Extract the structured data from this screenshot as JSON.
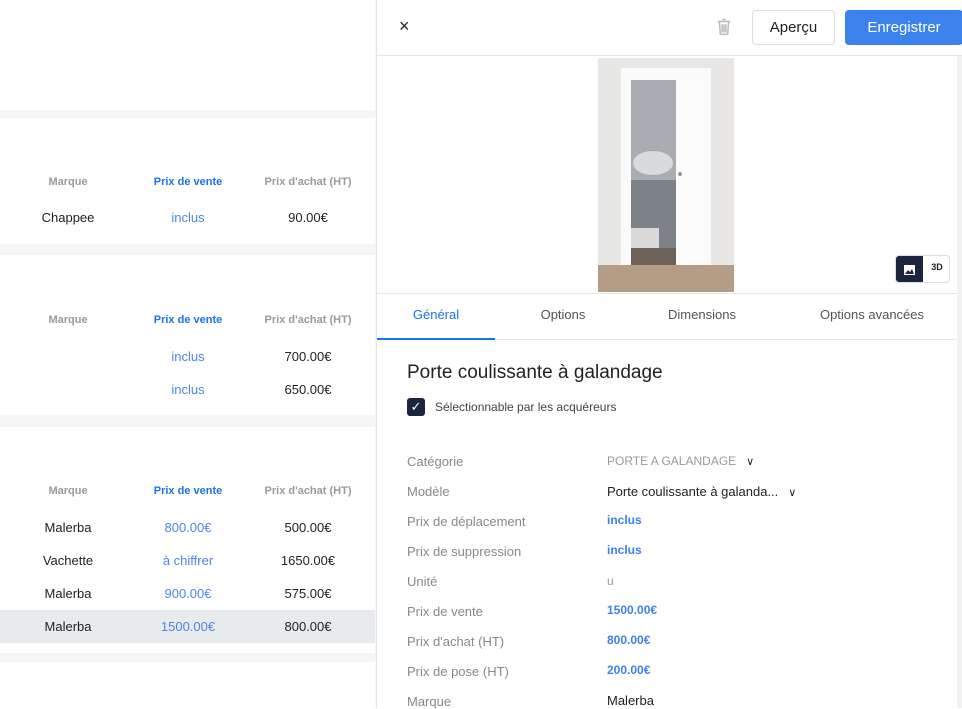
{
  "left": {
    "headers": {
      "brand": "Marque",
      "sale": "Prix de vente",
      "purchase": "Prix d'achat (HT)"
    },
    "cards": [
      {
        "rows": [
          {
            "brand": "Chappee",
            "sale": "inclus",
            "purchase": "90.00€"
          }
        ]
      },
      {
        "rows": [
          {
            "brand": "",
            "sale": "inclus",
            "purchase": "700.00€"
          },
          {
            "brand": "",
            "sale": "inclus",
            "purchase": "650.00€"
          }
        ]
      },
      {
        "rows": [
          {
            "brand": "Malerba",
            "sale": "800.00€",
            "purchase": "500.00€"
          },
          {
            "brand": "Vachette",
            "sale": "à chiffrer",
            "purchase": "1650.00€"
          },
          {
            "brand": "Malerba",
            "sale": "900.00€",
            "purchase": "575.00€"
          },
          {
            "brand": "Malerba",
            "sale": "1500.00€",
            "purchase": "800.00€",
            "selected": true
          }
        ]
      }
    ]
  },
  "header": {
    "close": "×",
    "preview": "Aperçu",
    "save": "Enregistrer"
  },
  "media": {
    "toggle_3d": "3D"
  },
  "tabs": [
    "Général",
    "Options",
    "Dimensions",
    "Options avancées"
  ],
  "product": {
    "title": "Porte coulissante à galandage",
    "selectable_label": "Sélectionnable par les acquéreurs",
    "selectable": true,
    "fields": [
      {
        "label": "Catégorie",
        "value": "PORTE A GALANDAGE"
      },
      {
        "label": "Modèle",
        "value": "Porte coulissante à galanda..."
      },
      {
        "label": "Prix de déplacement",
        "value": "inclus"
      },
      {
        "label": "Prix de suppression",
        "value": "inclus"
      },
      {
        "label": "Unité",
        "value": "u"
      },
      {
        "label": "Prix de vente",
        "value": "1500.00€"
      },
      {
        "label": "Prix d'achat (HT)",
        "value": "800.00€"
      },
      {
        "label": "Prix de pose (HT)",
        "value": "200.00€"
      },
      {
        "label": "Marque",
        "value": "Malerba"
      }
    ]
  },
  "colors": {
    "accent": "#3b82ec",
    "dark": "#1c2540"
  }
}
